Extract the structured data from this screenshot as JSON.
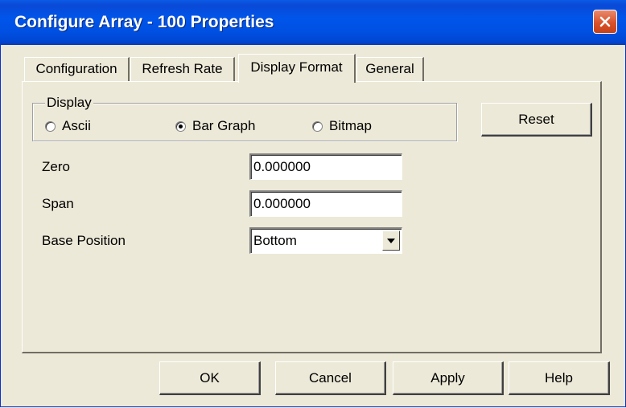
{
  "window": {
    "title": "Configure Array - 100 Properties"
  },
  "tabs": [
    {
      "label": "Configuration",
      "active": false
    },
    {
      "label": "Refresh Rate",
      "active": false
    },
    {
      "label": "Display Format",
      "active": true
    },
    {
      "label": "General",
      "active": false
    }
  ],
  "display_group": {
    "label": "Display",
    "options": [
      {
        "label": "Ascii",
        "checked": false
      },
      {
        "label": "Bar Graph",
        "checked": true
      },
      {
        "label": "Bitmap",
        "checked": false
      }
    ]
  },
  "reset_label": "Reset",
  "fields": {
    "zero": {
      "label": "Zero",
      "value": "0.000000"
    },
    "span": {
      "label": "Span",
      "value": "0.000000"
    },
    "base_position": {
      "label": "Base Position",
      "value": "Bottom"
    }
  },
  "footer": {
    "ok": "OK",
    "cancel": "Cancel",
    "apply": "Apply",
    "help": "Help"
  },
  "colors": {
    "titlebar": "#0055ea",
    "close_button": "#d9522b",
    "dialog_bg": "#ece9d8"
  }
}
